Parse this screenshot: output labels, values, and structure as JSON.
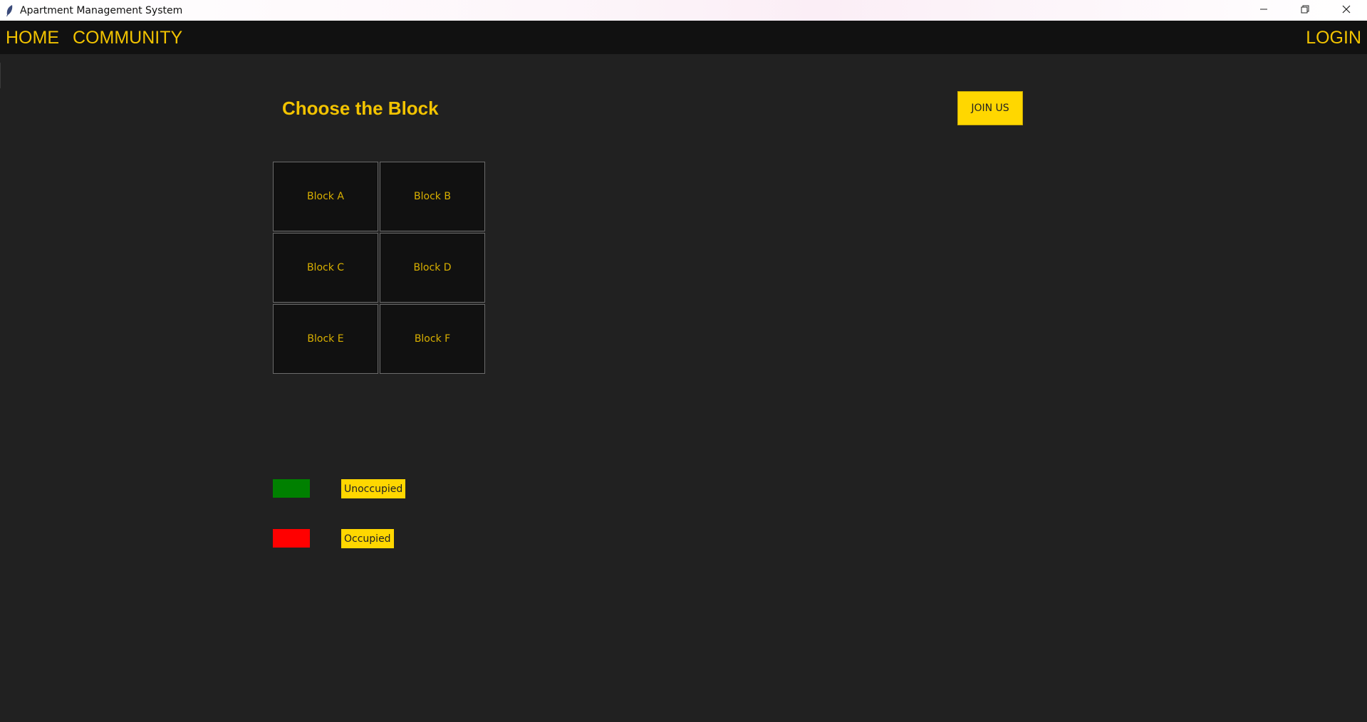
{
  "window": {
    "title": "Apartment Management System",
    "icon": "feather-icon",
    "controls": [
      "minimize-icon",
      "restore-icon",
      "close-icon"
    ]
  },
  "menu": {
    "home": "HOME",
    "community": "COMMUNITY",
    "login": "LOGIN"
  },
  "main": {
    "title": "Choose the Block",
    "join_label": "JOIN US",
    "blocks": [
      {
        "label": "Block A"
      },
      {
        "label": "Block B"
      },
      {
        "label": "Block C"
      },
      {
        "label": "Block D"
      },
      {
        "label": "Block E"
      },
      {
        "label": "Block F"
      }
    ]
  },
  "legend": [
    {
      "label": "Unoccupied",
      "color": "#008000"
    },
    {
      "label": "Occupied",
      "color": "#ff0000"
    }
  ],
  "colors": {
    "background": "#212121",
    "bar": "#111111",
    "accent": "#f2c300",
    "button": "#ffd700"
  }
}
